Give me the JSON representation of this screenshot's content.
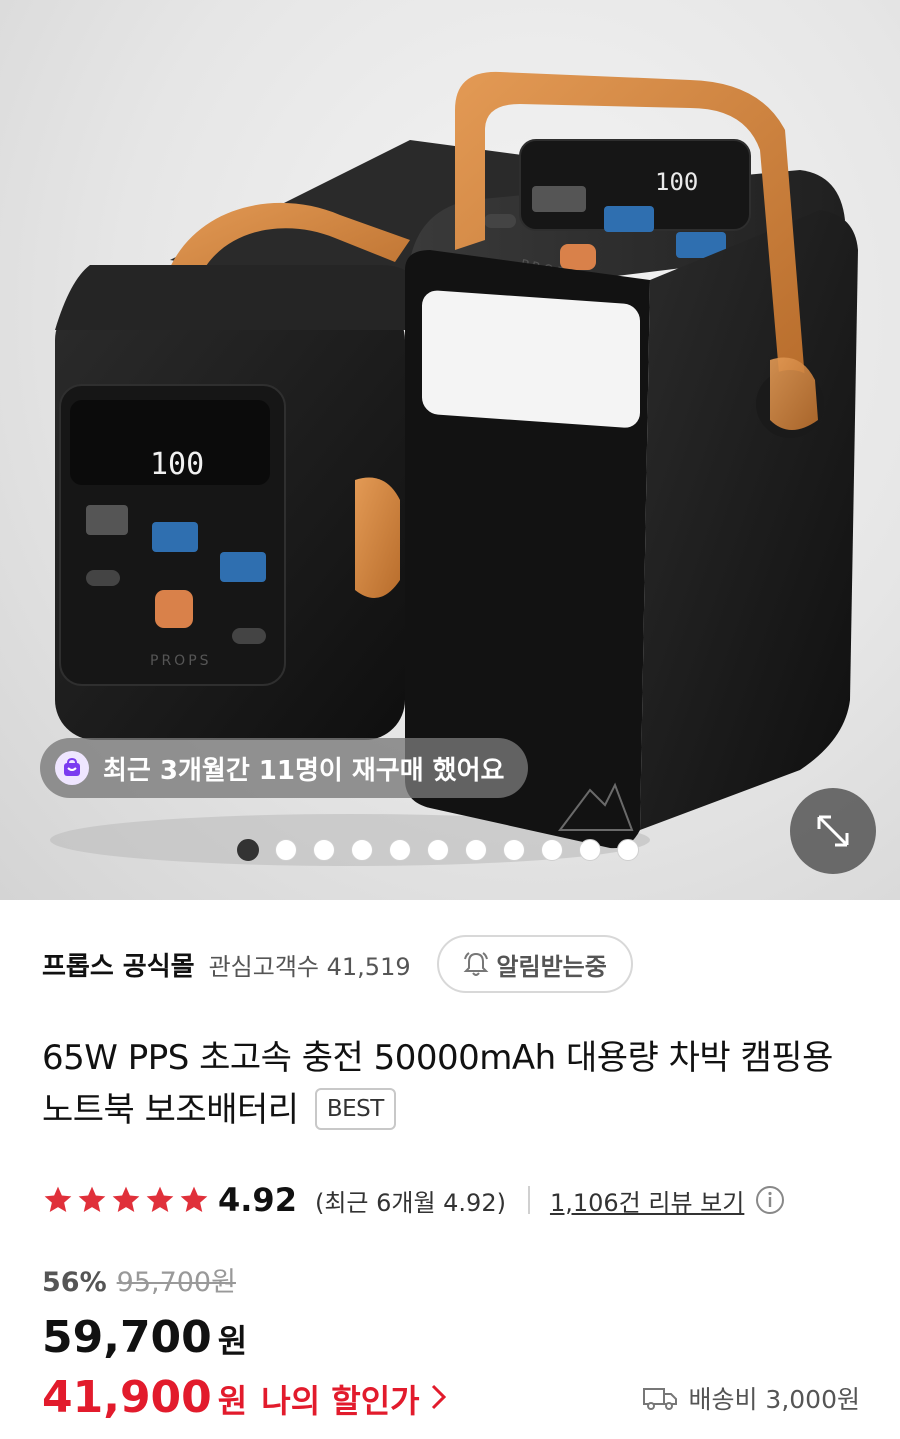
{
  "hero": {
    "rebuy_text": "최근 3개월간 11명이 재구매 했어요",
    "dots_total": 11,
    "dots_active": 1,
    "brand_print": "PROPS",
    "display_readout": "100",
    "display_unit": "%"
  },
  "store": {
    "name": "프롭스 공식몰",
    "followers_label": "관심고객수",
    "followers_count": "41,519",
    "notify_label": "알림받는중"
  },
  "product": {
    "title": "65W PPS 초고속 충전 50000mAh 대용량 차박 캠핑용 노트북 보조배터리",
    "badge": "BEST"
  },
  "rating": {
    "stars": 5,
    "score": "4.92",
    "recent_text": "(최근 6개월 4.92)",
    "reviews_link": "1,106건 리뷰 보기"
  },
  "price": {
    "discount_rate": "56%",
    "original": "95,700원",
    "current": "59,700",
    "currency": "원",
    "my_price": "41,900",
    "my_label": "나의 할인가",
    "shipping": "배송비 3,000원"
  },
  "colors": {
    "accent_red": "#e21b2c",
    "star_red": "#e0303a",
    "handle_orange": "#d98a44"
  }
}
